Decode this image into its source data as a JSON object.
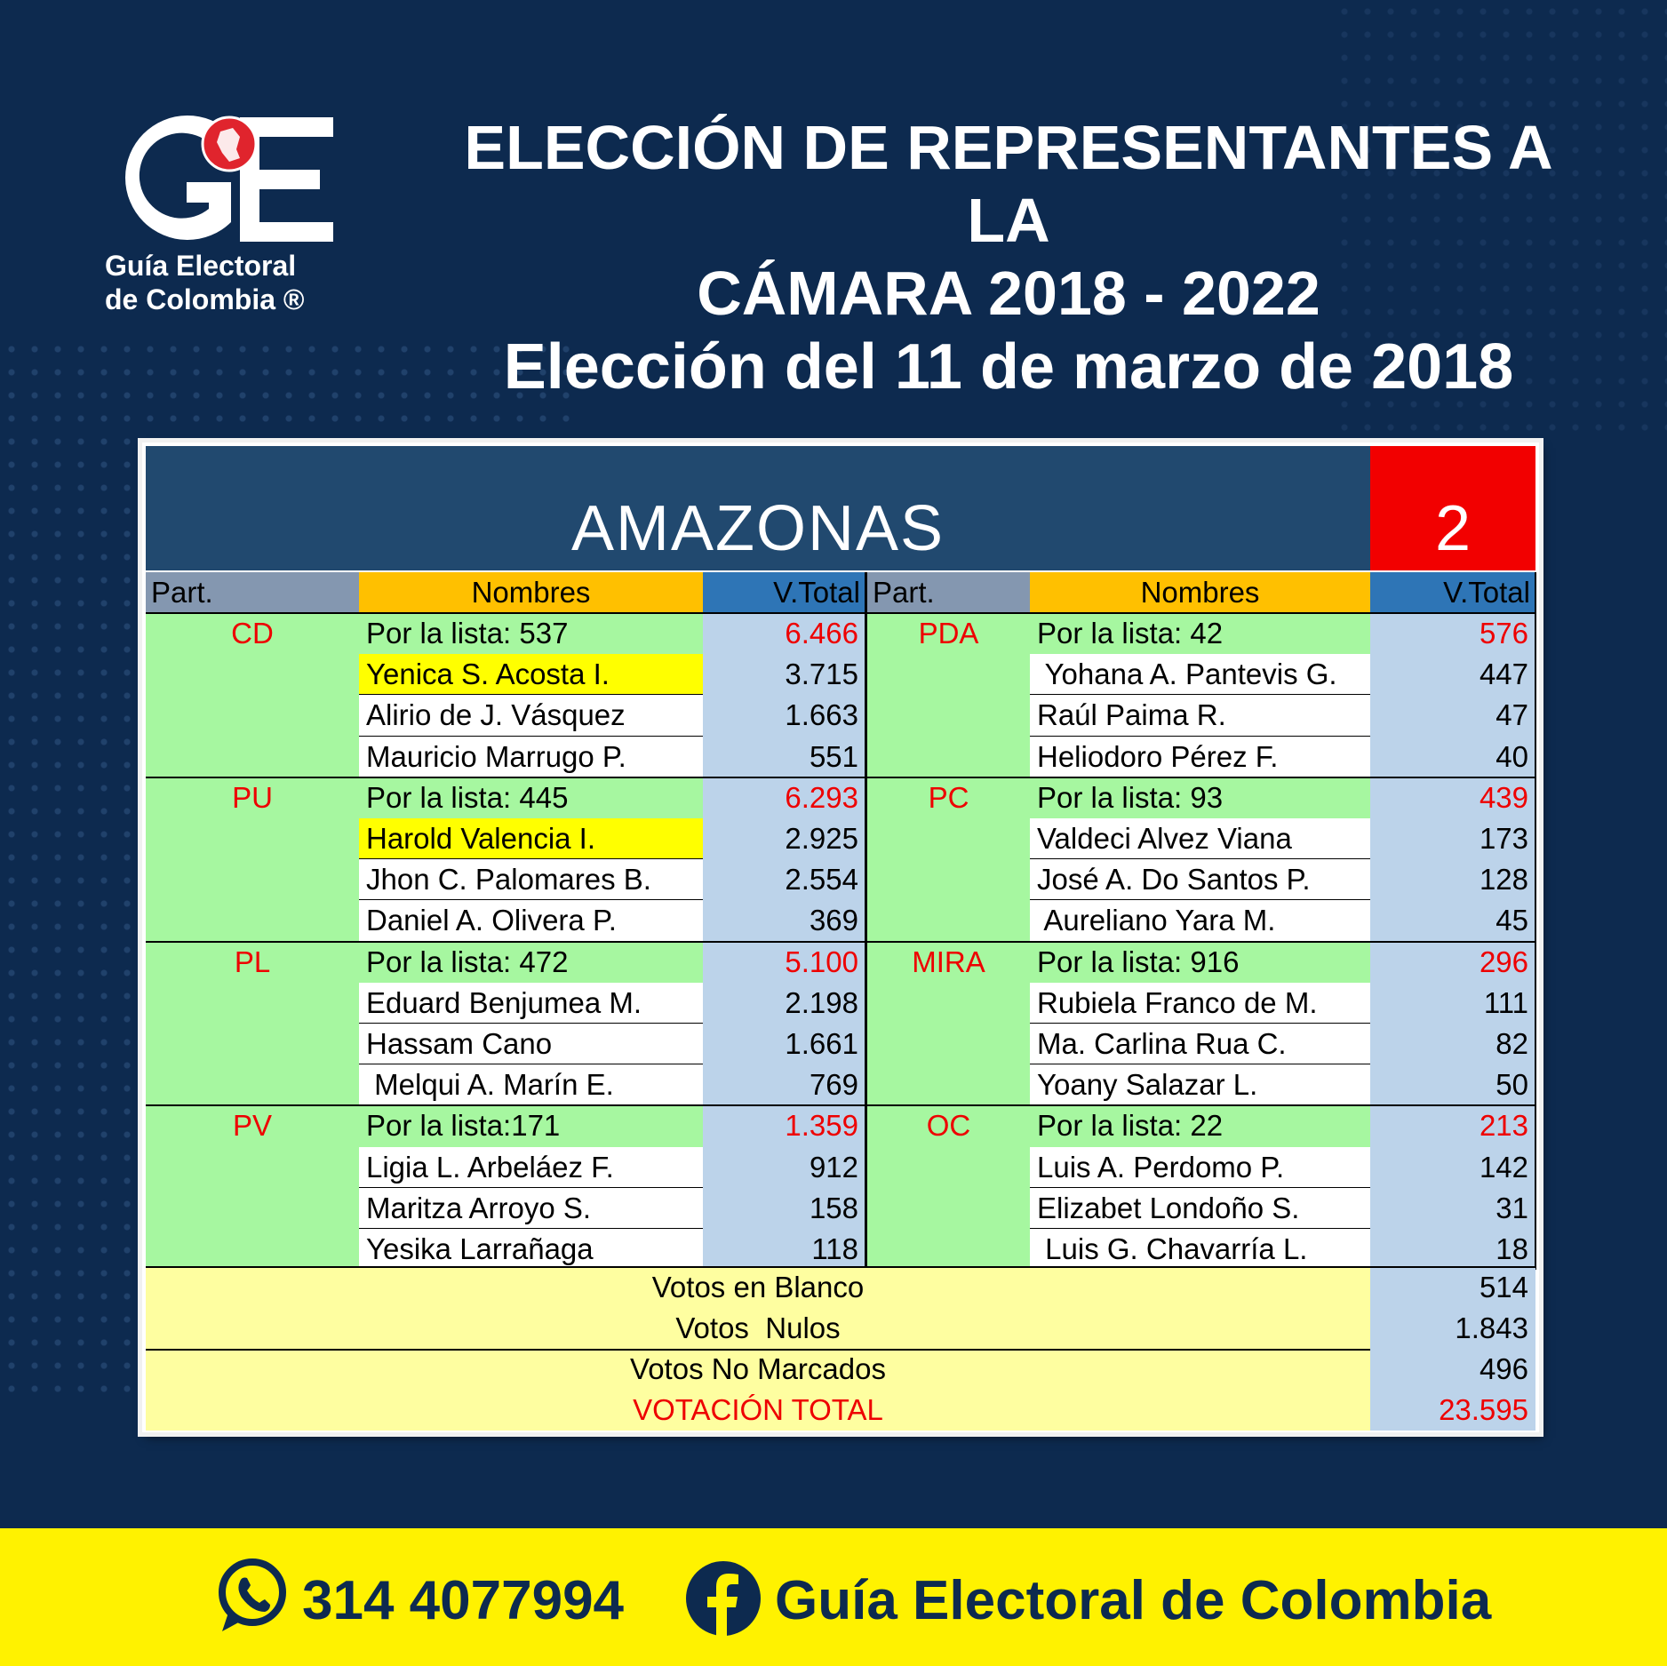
{
  "logo": {
    "line1": "Guía Electoral",
    "line2": "de Colombia ®"
  },
  "header": {
    "title_line1": "ELECCIÓN DE REPRESENTANTES A LA",
    "title_line2": "CÁMARA 2018 - 2022",
    "subtitle": "Elección del 11 de marzo de 2018"
  },
  "table": {
    "department": "AMAZONAS",
    "seats": "2",
    "col_part": "Part.",
    "col_names": "Nombres",
    "col_vtotal": "V.Total",
    "left": [
      {
        "party": "CD",
        "rows": [
          [
            "Por la lista: 537",
            "6.466"
          ],
          [
            "Yenica S. Acosta I.",
            "3.715"
          ],
          [
            "Alirio de J. Vásquez",
            "1.663"
          ],
          [
            "Mauricio Marrugo P.",
            "551"
          ]
        ]
      },
      {
        "party": "PU",
        "rows": [
          [
            "Por la lista: 445",
            "6.293"
          ],
          [
            "Harold Valencia I.",
            "2.925"
          ],
          [
            "Jhon C. Palomares B.",
            "2.554"
          ],
          [
            "Daniel A. Olivera P.",
            "369"
          ]
        ]
      },
      {
        "party": "PL",
        "rows": [
          [
            "Por la lista: 472",
            "5.100"
          ],
          [
            "Eduard Benjumea M.",
            "2.198"
          ],
          [
            "Hassam Cano",
            "1.661"
          ],
          [
            " Melqui A. Marín E.",
            "769"
          ]
        ]
      },
      {
        "party": "PV",
        "rows": [
          [
            "Por la lista:171",
            "1.359"
          ],
          [
            "Ligia L. Arbeláez F.",
            "912"
          ],
          [
            "Maritza Arroyo S.",
            "158"
          ],
          [
            "Yesika Larrañaga",
            "118"
          ]
        ]
      }
    ],
    "right": [
      {
        "party": "PDA",
        "rows": [
          [
            "Por la lista: 42",
            "576"
          ],
          [
            " Yohana A. Pantevis G.",
            "447"
          ],
          [
            "Raúl Paima R.",
            "47"
          ],
          [
            "Heliodoro Pérez F.",
            "40"
          ]
        ]
      },
      {
        "party": "PC",
        "rows": [
          [
            "Por la lista: 93",
            "439"
          ],
          [
            "Valdeci Alvez Viana",
            "173"
          ],
          [
            "José A. Do Santos P.",
            "128"
          ],
          [
            " Aureliano Yara M.",
            "45"
          ]
        ]
      },
      {
        "party": "MIRA",
        "rows": [
          [
            "Por la lista: 916",
            "296"
          ],
          [
            "Rubiela Franco de M.",
            "111"
          ],
          [
            "Ma. Carlina Rua C.",
            "82"
          ],
          [
            "Yoany Salazar L.",
            "50"
          ]
        ]
      },
      {
        "party": "OC",
        "rows": [
          [
            "Por la lista: 22",
            "213"
          ],
          [
            "Luis A. Perdomo P.",
            "142"
          ],
          [
            "Elizabet Londoño S.",
            "31"
          ],
          [
            " Luis G. Chavarría L.",
            "18"
          ]
        ]
      }
    ],
    "totals": [
      {
        "label": "Votos en Blanco",
        "value": "514"
      },
      {
        "label": "Votos  Nulos",
        "value": "1.843"
      },
      {
        "label": "Votos No Marcados",
        "value": "496"
      },
      {
        "label": "VOTACIÓN TOTAL",
        "value": "23.595"
      }
    ]
  },
  "footer": {
    "phone": "314 4077994",
    "name": "Guía Electoral de Colombia"
  },
  "colors": {
    "background": "#0d2a4f",
    "footer": "#fff200",
    "accent_red": "#ee0000"
  }
}
